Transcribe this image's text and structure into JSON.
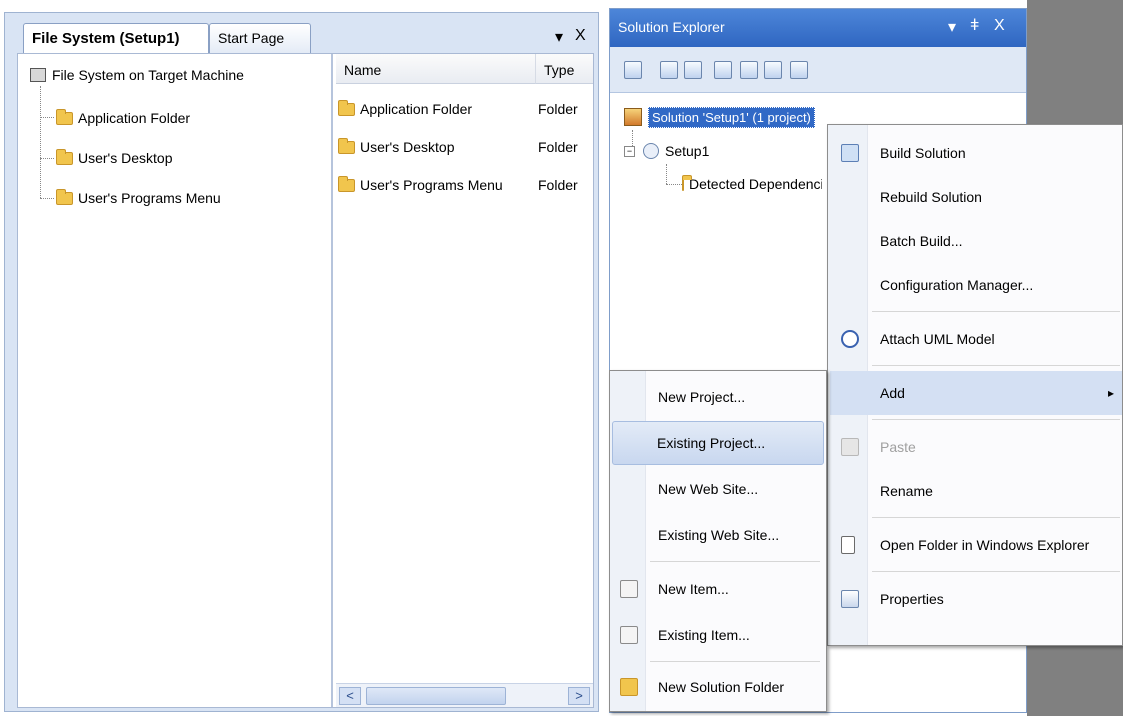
{
  "file_system_window": {
    "tabs": [
      {
        "label": "File System (Setup1)"
      },
      {
        "label": "Start Page"
      }
    ],
    "dropdown_glyph": "▾",
    "close_glyph": "X",
    "tree": {
      "root": "File System on Target Machine",
      "children": [
        "Application Folder",
        "User's Desktop",
        "User's Programs Menu"
      ]
    },
    "list": {
      "columns": {
        "name": "Name",
        "type": "Type"
      },
      "rows": [
        {
          "name": "Application Folder",
          "type": "Folder"
        },
        {
          "name": "User's Desktop",
          "type": "Folder"
        },
        {
          "name": "User's Programs Menu",
          "type": "Folder"
        }
      ],
      "scroll_left": "<",
      "scroll_right": ">"
    }
  },
  "solution_explorer": {
    "title": "Solution Explorer",
    "title_controls": {
      "dropdown": "▾",
      "pin": "ǂ",
      "close": "X"
    },
    "tree": {
      "solution": "Solution 'Setup1' (1 project)",
      "project": "Setup1",
      "detected": "Detected Dependencies"
    }
  },
  "context_menu": {
    "items": [
      {
        "label": "Build Solution",
        "icon": "build-solution-icon"
      },
      {
        "label": "Rebuild Solution"
      },
      {
        "label": "Batch Build..."
      },
      {
        "label": "Configuration Manager..."
      },
      {
        "label": "Attach UML Model",
        "icon": "uml-model-icon"
      },
      {
        "label": "Add",
        "submenu_arrow": "▸"
      },
      {
        "label": "Paste",
        "icon": "paste-icon",
        "disabled": true
      },
      {
        "label": "Rename"
      },
      {
        "label": "Open Folder in Windows Explorer",
        "icon": "open-folder-icon"
      },
      {
        "label": "Properties",
        "icon": "properties-icon"
      }
    ]
  },
  "add_submenu": {
    "items": [
      {
        "label": "New Project..."
      },
      {
        "label": "Existing Project...",
        "highlighted": true
      },
      {
        "label": "New Web Site..."
      },
      {
        "label": "Existing Web Site..."
      },
      {
        "label": "New Item...",
        "icon": "new-item-icon"
      },
      {
        "label": "Existing Item...",
        "icon": "existing-item-icon"
      },
      {
        "label": "New Solution Folder",
        "icon": "new-solution-folder-icon"
      }
    ]
  },
  "colors": {
    "title_blue": "#2f66c1",
    "selection_blue": "#3169c6",
    "menu_highlight": "#c8d7ef",
    "background_gray": "#808080"
  }
}
